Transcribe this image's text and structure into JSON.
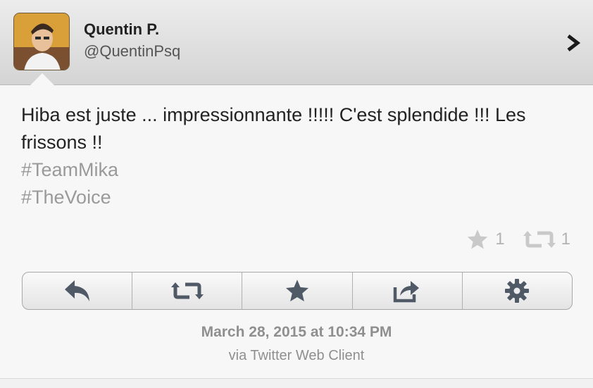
{
  "user": {
    "name": "Quentin P.",
    "handle": "@QuentinPsq"
  },
  "tweet": {
    "text": "Hiba est juste ... impressionnante !!!!! C'est splendide !!! Les frissons !!",
    "hashtags": [
      "#TeamMika",
      "#TheVoice"
    ]
  },
  "stats": {
    "favorites": "1",
    "retweets": "1"
  },
  "toolbar": {
    "icons": [
      "reply-icon",
      "retweet-icon",
      "favorite-icon",
      "share-icon",
      "settings-icon"
    ]
  },
  "meta": {
    "timestamp": "March 28, 2015 at 10:34 PM",
    "via": "via Twitter Web Client"
  },
  "colors": {
    "icon": "#505a66",
    "muted": "#b3b3b3",
    "hashtag": "#9a9a9a"
  }
}
